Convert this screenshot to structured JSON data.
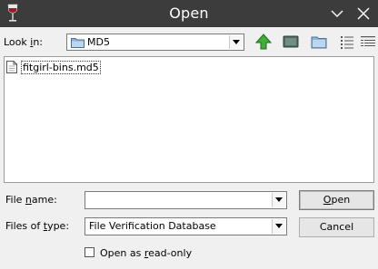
{
  "window": {
    "title": "Open"
  },
  "lookin": {
    "label_pre": "Look ",
    "label_key": "i",
    "label_post": "n:",
    "value": "MD5"
  },
  "toolbar": {
    "up_icon": "green-up-arrow-icon",
    "desktop_icon": "desktop-icon",
    "new_folder_icon": "new-folder-icon",
    "list_icon": "list-view-icon",
    "details_icon": "details-view-icon"
  },
  "files": [
    {
      "name": "fitgirl-bins.md5"
    }
  ],
  "filename": {
    "label_pre": "File ",
    "label_key": "n",
    "label_post": "ame:",
    "value": ""
  },
  "filetype": {
    "label_pre": "Files of ",
    "label_key": "t",
    "label_post": "ype:",
    "value": "File Verification Database"
  },
  "buttons": {
    "open_key": "O",
    "open_rest": "pen",
    "cancel": "Cancel"
  },
  "readonly": {
    "label_pre": "Open as ",
    "label_key": "r",
    "label_post": "ead-only",
    "checked": false
  }
}
